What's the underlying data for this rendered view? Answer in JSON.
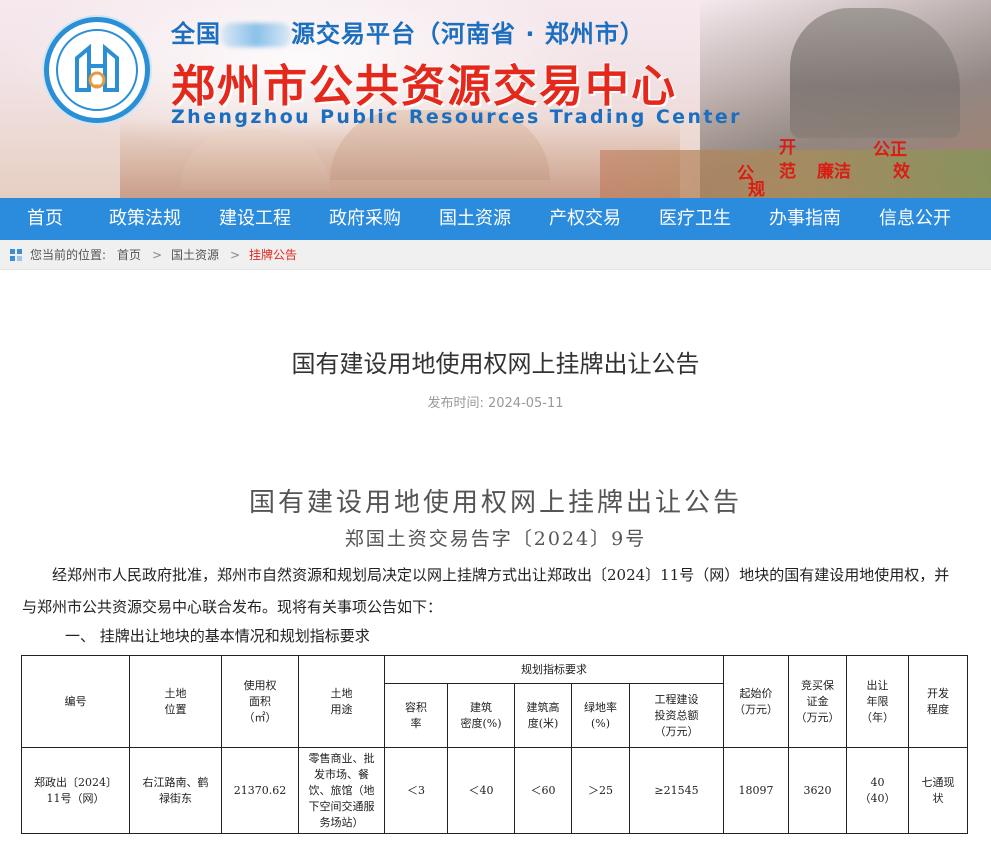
{
  "banner": {
    "title_small_left": "全国",
    "title_small_right": "源交易平台（河南省 · 郑州市）",
    "title_main": "郑州市公共资源交易中心",
    "title_en": "Zhengzhou Public Resources Trading Center",
    "slogan": [
      "开",
      "公正",
      "范",
      "廉洁",
      "效",
      "公",
      "规"
    ]
  },
  "nav": {
    "items": [
      "首页",
      "政策法规",
      "建设工程",
      "政府采购",
      "国土资源",
      "产权交易",
      "医疗卫生",
      "办事指南",
      "信息公开"
    ]
  },
  "breadcrumb": {
    "prefix": "您当前的位置:",
    "items": [
      "首页",
      "国土资源",
      "挂牌公告"
    ],
    "separator": ">"
  },
  "article": {
    "title": "国有建设用地使用权网上挂牌出让公告",
    "date": "发布时间:  2024-05-11",
    "doc_title": "国有建设用地使用权网上挂牌出让公告",
    "doc_number": "郑国土资交易告字〔2024〕9号",
    "intro": "经郑州市人民政府批准，郑州市自然资源和规划局决定以网上挂牌方式出让郑政出〔2024〕11号（网）地块的国有建设用地使用权，并与郑州市公共资源交易中心联合发布。现将有关事项公告如下：",
    "section_1": "一、  挂牌出让地块的基本情况和规划指标要求"
  },
  "table": {
    "group_header": "规划指标要求",
    "headers": {
      "id": "编号",
      "location": "土地\n位置",
      "area": "使用权\n面积\n（㎡）",
      "use": "土地\n用途",
      "far": "容积\n率",
      "density": "建筑\n密度(%)",
      "height": "建筑高\n度(米)",
      "green": "绿地率\n(%)",
      "invest": "工程建设\n投资总额\n（万元）",
      "start_price": "起始价\n（万元）",
      "deposit": "竞买保\n证金\n（万元）",
      "term": "出让\n年限\n（年）",
      "dev": "开发\n程度"
    },
    "rows": [
      {
        "id": "郑政出〔2024〕\n11号（网）",
        "location": "右江路南、鹤\n禄街东",
        "area": "21370.62",
        "use": "零售商业、批\n发市场、餐\n饮、旅馆（地\n下空间交通服\n务场站）",
        "far": "＜3",
        "density": "＜40",
        "height": "＜60",
        "green": "＞25",
        "invest": "≥21545",
        "start_price": "18097",
        "deposit": "3620",
        "term": "40\n（40）",
        "dev": "七通现\n状"
      }
    ]
  },
  "colors": {
    "nav_bg": "#2b8bdc",
    "title_red": "#e5281c",
    "title_blue": "#1c6fc0",
    "crumb_current": "#e5281c"
  },
  "icons": {
    "logo": "zhengzhou-logo-icon",
    "breadcrumb": "location-grid-icon"
  }
}
